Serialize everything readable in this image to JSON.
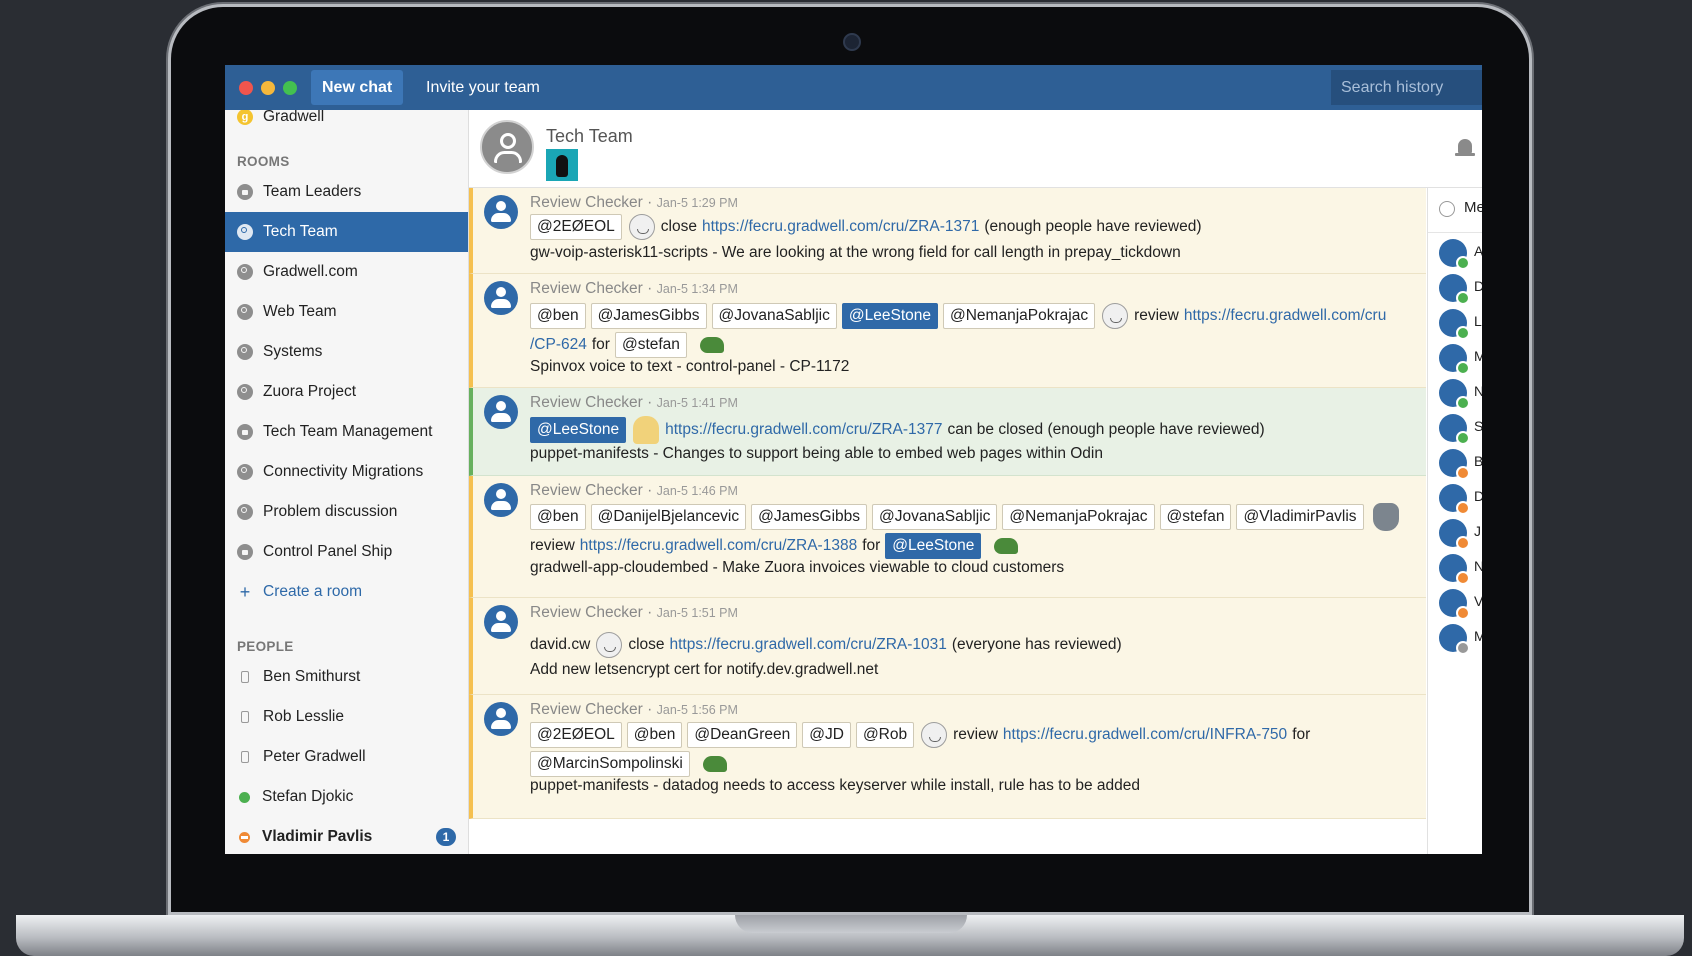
{
  "topbar": {
    "new_chat": "New chat",
    "invite": "Invite your team",
    "search_placeholder": "Search history"
  },
  "sidebar": {
    "org_name": "Gradwell",
    "rooms_heading": "ROOMS",
    "rooms": [
      {
        "label": "Team Leaders",
        "icon": "lock-icon"
      },
      {
        "label": "Tech Team",
        "icon": "group-icon",
        "active": true
      },
      {
        "label": "Gradwell.com",
        "icon": "group-icon"
      },
      {
        "label": "Web Team",
        "icon": "group-icon"
      },
      {
        "label": "Systems",
        "icon": "group-icon"
      },
      {
        "label": "Zuora Project",
        "icon": "group-icon"
      },
      {
        "label": "Tech Team Management",
        "icon": "lock-icon"
      },
      {
        "label": "Connectivity Migrations",
        "icon": "group-icon"
      },
      {
        "label": "Problem discussion",
        "icon": "group-icon"
      },
      {
        "label": "Control Panel Ship",
        "icon": "lock-icon"
      }
    ],
    "create_room": "Create a room",
    "people_heading": "PEOPLE",
    "people": [
      {
        "label": "Ben Smithurst",
        "status": "mobile"
      },
      {
        "label": "Rob Lesslie",
        "status": "mobile"
      },
      {
        "label": "Peter Gradwell",
        "status": "mobile"
      },
      {
        "label": "Stefan Djokic",
        "status": "online"
      },
      {
        "label": "Vladimir Pavlis",
        "status": "away",
        "unread": "1"
      }
    ]
  },
  "room": {
    "title": "Tech Team"
  },
  "messages": [
    {
      "author": "Review Checker",
      "time": "Jan-5 1:29 PM",
      "mentions": [
        "@2EØEOL"
      ],
      "verb": "close",
      "link": "https://fecru.gradwell.com/cru/ZRA-1371",
      "suffix": "(enough people have reviewed)",
      "body": "gw-voip-asterisk11-scripts - We are looking at the wrong field for call length in prepay_tickdown"
    },
    {
      "author": "Review Checker",
      "time": "Jan-5 1:34 PM",
      "mentions": [
        "@ben",
        "@JamesGibbs",
        "@JovanaSabljic",
        "@LeeStone",
        "@NemanjaPokrajac"
      ],
      "verb": "review",
      "link_part1": "https://fecru.gradwell.com/cru",
      "link_part2": "/CP-624",
      "for_text": "for",
      "for_mention": "@stefan",
      "body": "Spinvox voice to text - control-panel - CP-1172"
    },
    {
      "author": "Review Checker",
      "time": "Jan-5 1:41 PM",
      "mentions": [
        "@LeeStone"
      ],
      "link": "https://fecru.gradwell.com/cru/ZRA-1377",
      "suffix": "can be closed (enough people have reviewed)",
      "body": "puppet-manifests - Changes to support being able to embed web pages within Odin"
    },
    {
      "author": "Review Checker",
      "time": "Jan-5 1:46 PM",
      "mentions": [
        "@ben",
        "@DanijelBjelancevic",
        "@JamesGibbs",
        "@JovanaSabljic",
        "@NemanjaPokrajac",
        "@stefan",
        "@VladimirPavlis"
      ],
      "verb": "review",
      "link": "https://fecru.gradwell.com/cru/ZRA-1388",
      "for_text": "for",
      "for_mention": "@LeeStone",
      "body": "gradwell-app-cloudembed - Make Zuora invoices viewable to cloud customers"
    },
    {
      "author": "Review Checker",
      "time": "Jan-5 1:51 PM",
      "plain_user": "david.cw",
      "verb": "close",
      "link": "https://fecru.gradwell.com/cru/ZRA-1031",
      "suffix": "(everyone has reviewed)",
      "body": "Add new letsencrypt cert for notify.dev.gradwell.net"
    },
    {
      "author": "Review Checker",
      "time": "Jan-5 1:56 PM",
      "mentions": [
        "@2EØEOL",
        "@ben",
        "@DeanGreen",
        "@JD",
        "@Rob"
      ],
      "verb": "review",
      "link": "https://fecru.gradwell.com/cru/INFRA-750",
      "for_text": "for",
      "for_mention": "@MarcinSompolinski",
      "body": "puppet-manifests - datadog needs to access keyserver while install, rule has to be added"
    }
  ],
  "members": {
    "header": "Me",
    "initials": [
      {
        "letter": "A",
        "status": "online"
      },
      {
        "letter": "D",
        "status": "online"
      },
      {
        "letter": "L",
        "status": "online"
      },
      {
        "letter": "M",
        "status": "online"
      },
      {
        "letter": "N",
        "status": "online"
      },
      {
        "letter": "S",
        "status": "online"
      },
      {
        "letter": "B",
        "status": "away"
      },
      {
        "letter": "D",
        "status": "away"
      },
      {
        "letter": "J",
        "status": "away"
      },
      {
        "letter": "N",
        "status": "away"
      },
      {
        "letter": "V",
        "status": "away"
      },
      {
        "letter": "M",
        "status": "mobile"
      }
    ]
  },
  "colors": {
    "topbar": "#2e5f95",
    "accent": "#2f69a8",
    "message_bg": "#fbf6e5",
    "message_border": "#f5c04f",
    "message_highlight_bg": "#e8f1e5",
    "online": "#4cb050",
    "away": "#f08a35"
  }
}
